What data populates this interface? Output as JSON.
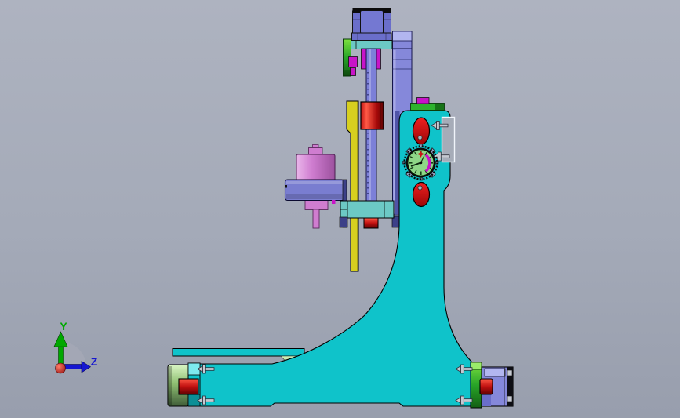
{
  "viewport": {
    "triad": {
      "y_label": "Y",
      "z_label": "Z"
    },
    "palette": {
      "bg_top": "#aeb3c0",
      "bg_mid": "#a4aab8",
      "bg_bottom": "#989ead",
      "cyan": "#0fc3ca",
      "cyan_soft": "#6cc9c5",
      "cyan_pale": "#7de9ef",
      "teal_dark": "#0c8f96",
      "purple": "#8588da",
      "purple_pale": "#b2b6f0",
      "purple_med": "#6a6eca",
      "block_inner": "#7478d2",
      "navy": "#3c4088",
      "indigo_shadow": "#5054a8",
      "rod": "#7c80d8",
      "flange": "#797dd0",
      "yellow": "#d7cf1f",
      "red": "#c41414",
      "pink": "#cf7dd0",
      "green": "#2db32d",
      "green_deep": "#177317",
      "sage": "#c9ecb2",
      "magenta": "#c814c8",
      "dial_face": "#8fd687",
      "dial_tick": "#173f17",
      "lug": "#96a0c2",
      "screw": "#c6cad2",
      "screw_dark": "#2e2e38",
      "slot": "#a6acb8",
      "slot_edge": "#f0f4fa",
      "axis_y": "#00a800",
      "axis_z": "#1616d0",
      "axis_x": "#cc1414",
      "wedge": "#a3a7b5"
    },
    "parts": [
      {
        "name": "base-and-column",
        "color_key": "cyan"
      },
      {
        "name": "vertical-guide-column",
        "color_key": "purple"
      },
      {
        "name": "top-motor-bracket",
        "color_key": "purple_med"
      },
      {
        "name": "slide-rod-with-scale",
        "color_key": "rod"
      },
      {
        "name": "yellow-slide-plate",
        "color_key": "yellow"
      },
      {
        "name": "red-clamp-cylinder",
        "color_key": "red"
      },
      {
        "name": "pink-spindle-motor",
        "color_key": "pink"
      },
      {
        "name": "spindle-flange",
        "color_key": "flange"
      },
      {
        "name": "cross-arm",
        "color_key": "cyan_soft"
      },
      {
        "name": "dial-indicator",
        "color_key": "dial_face"
      },
      {
        "name": "red-oval-knobs",
        "color_key": "red"
      },
      {
        "name": "left-foot-roller",
        "color_key": "sage"
      },
      {
        "name": "right-foot-bearing-block",
        "color_key": "purple"
      },
      {
        "name": "anvil-bar",
        "color_key": "cyan"
      }
    ]
  }
}
